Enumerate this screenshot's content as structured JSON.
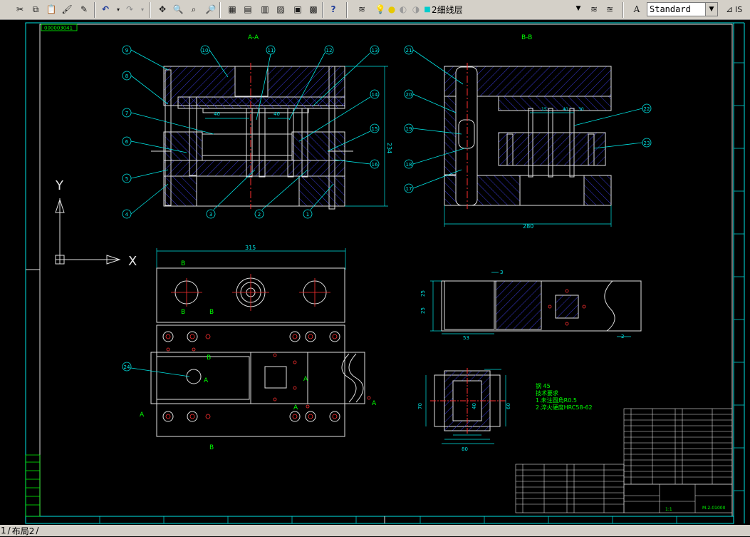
{
  "toolbar": {
    "layer_name": "2细线层",
    "text_style": "Standard",
    "right_fragment": "IS"
  },
  "drawing": {
    "view_a_title": "A-A",
    "view_b_title": "B-B",
    "width_dim_b": "280",
    "height_dim_a": "234",
    "plan_width_dim": "315",
    "axis_y": "Y",
    "axis_x": "X",
    "section_b": "B",
    "section_a": "A",
    "balloons_a": [
      "9",
      "8",
      "7",
      "6",
      "5",
      "4",
      "10",
      "11",
      "12",
      "13",
      "14",
      "15",
      "16",
      "1",
      "2",
      "3"
    ],
    "balloons_b": [
      "21",
      "20",
      "19",
      "18",
      "17",
      "22",
      "23"
    ],
    "plan_balloon": "24",
    "part_dims": {
      "d1": "25",
      "d2": "25",
      "d3": "53",
      "d4": "3",
      "d5": "2",
      "d6": "70",
      "d7": "40",
      "d8": "60",
      "d9": "80"
    },
    "notes": [
      "钢 45",
      "技术要求",
      "1.未注圆角R0.5",
      "2.淬火硬度HRC58-62"
    ],
    "title_block": {
      "scale": "1:1",
      "drawing_no": "M-2-01000"
    },
    "dim_labels_a": [
      "40",
      "40"
    ],
    "b_dims": [
      "15",
      "40",
      "30"
    ],
    "corner_label": "000003041"
  },
  "status": {
    "tab_prefix": "1",
    "tab_layout2": "布局2"
  }
}
